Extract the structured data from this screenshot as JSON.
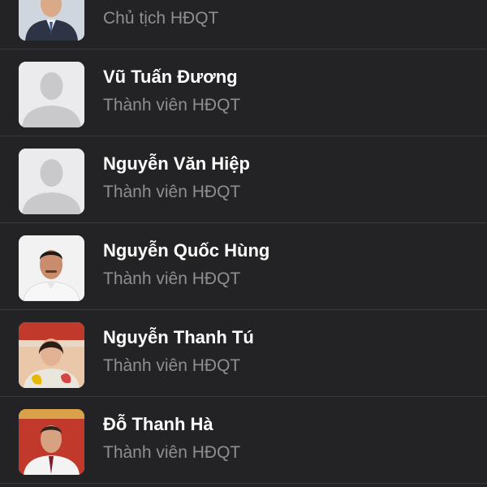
{
  "members": [
    {
      "name": "",
      "role": "Chủ tịch HĐQT",
      "avatar": "chairman-photo"
    },
    {
      "name": "Vũ Tuấn Đương",
      "role": "Thành viên HĐQT",
      "avatar": "placeholder-person-icon"
    },
    {
      "name": "Nguyễn Văn Hiệp",
      "role": "Thành viên HĐQT",
      "avatar": "placeholder-person-icon"
    },
    {
      "name": "Nguyễn Quốc Hùng",
      "role": "Thành viên HĐQT",
      "avatar": "male-portrait-photo"
    },
    {
      "name": "Nguyễn Thanh Tú",
      "role": "Thành viên HĐQT",
      "avatar": "female-portrait-photo"
    },
    {
      "name": "Đỗ Thanh Hà",
      "role": "Thành viên HĐQT",
      "avatar": "male-portrait-photo"
    }
  ],
  "colors": {
    "background": "#232325",
    "separator": "#3a3a3c",
    "name_text": "#ffffff",
    "role_text": "#8e8e93"
  }
}
